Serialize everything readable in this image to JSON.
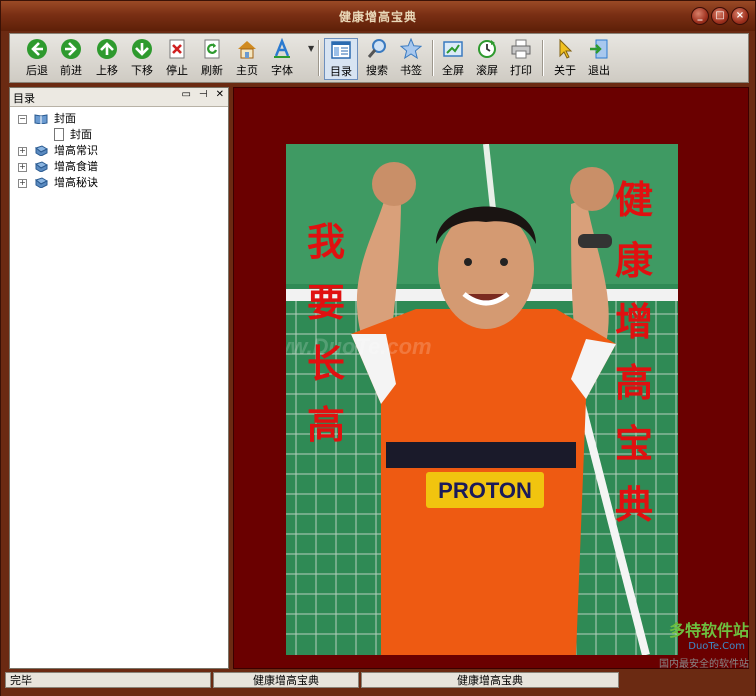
{
  "window": {
    "title": "健康增高宝典",
    "minimize_icon": "minimize-icon",
    "maximize_icon": "maximize-icon",
    "close_icon": "close-icon"
  },
  "toolbar": {
    "buttons": [
      {
        "label": "后退",
        "icon": "back-arrow-icon",
        "color": "#2e9a2e"
      },
      {
        "label": "前进",
        "icon": "forward-arrow-icon",
        "color": "#2e9a2e"
      },
      {
        "label": "上移",
        "icon": "up-arrow-icon",
        "color": "#2e9a2e"
      },
      {
        "label": "下移",
        "icon": "down-arrow-icon",
        "color": "#2e9a2e"
      },
      {
        "label": "停止",
        "icon": "stop-icon",
        "color": "#d02020"
      },
      {
        "label": "刷新",
        "icon": "refresh-icon",
        "color": "#2e9a2e"
      },
      {
        "label": "主页",
        "icon": "home-icon",
        "color": "#d08a20"
      },
      {
        "label": "字体",
        "icon": "font-icon",
        "color": "#2a7ad0"
      },
      {
        "label": "目录",
        "icon": "contents-icon",
        "color": "#2a6ab0"
      },
      {
        "label": "搜索",
        "icon": "search-icon",
        "color": "#3a7ac0"
      },
      {
        "label": "书签",
        "icon": "bookmark-star-icon",
        "color": "#3a7ac0"
      },
      {
        "label": "全屏",
        "icon": "fullscreen-icon",
        "color": "#3a7ac0"
      },
      {
        "label": "滚屏",
        "icon": "auto-scroll-icon",
        "color": "#2e9a2e"
      },
      {
        "label": "打印",
        "icon": "print-icon",
        "color": "#777777"
      },
      {
        "label": "关于",
        "icon": "about-cursor-icon",
        "color": "#d0a020"
      },
      {
        "label": "退出",
        "icon": "exit-icon",
        "color": "#2a7ad0"
      }
    ]
  },
  "sidebar": {
    "title": "目录",
    "tree": [
      {
        "label": "封面",
        "expanded": true,
        "children": [
          {
            "label": "封面"
          }
        ]
      },
      {
        "label": "增高常识",
        "expanded": false
      },
      {
        "label": "增高食谱",
        "expanded": false
      },
      {
        "label": "增高秘诀",
        "expanded": false
      }
    ]
  },
  "content": {
    "left_text": [
      "我",
      "要",
      "长",
      "高"
    ],
    "right_text": [
      "健",
      "康",
      "增",
      "高",
      "宝",
      "典"
    ],
    "jersey_text": "PROTON",
    "watermark": "www.DuoTe.com",
    "corner_logo": "多特软件站",
    "corner_logo_url": "DuoTe.Com",
    "corner_slogan": "国内最安全的软件站",
    "bg_color": "#6a0000"
  },
  "status": {
    "left": "完毕",
    "mid": "健康增高宝典",
    "right": "健康增高宝典"
  }
}
